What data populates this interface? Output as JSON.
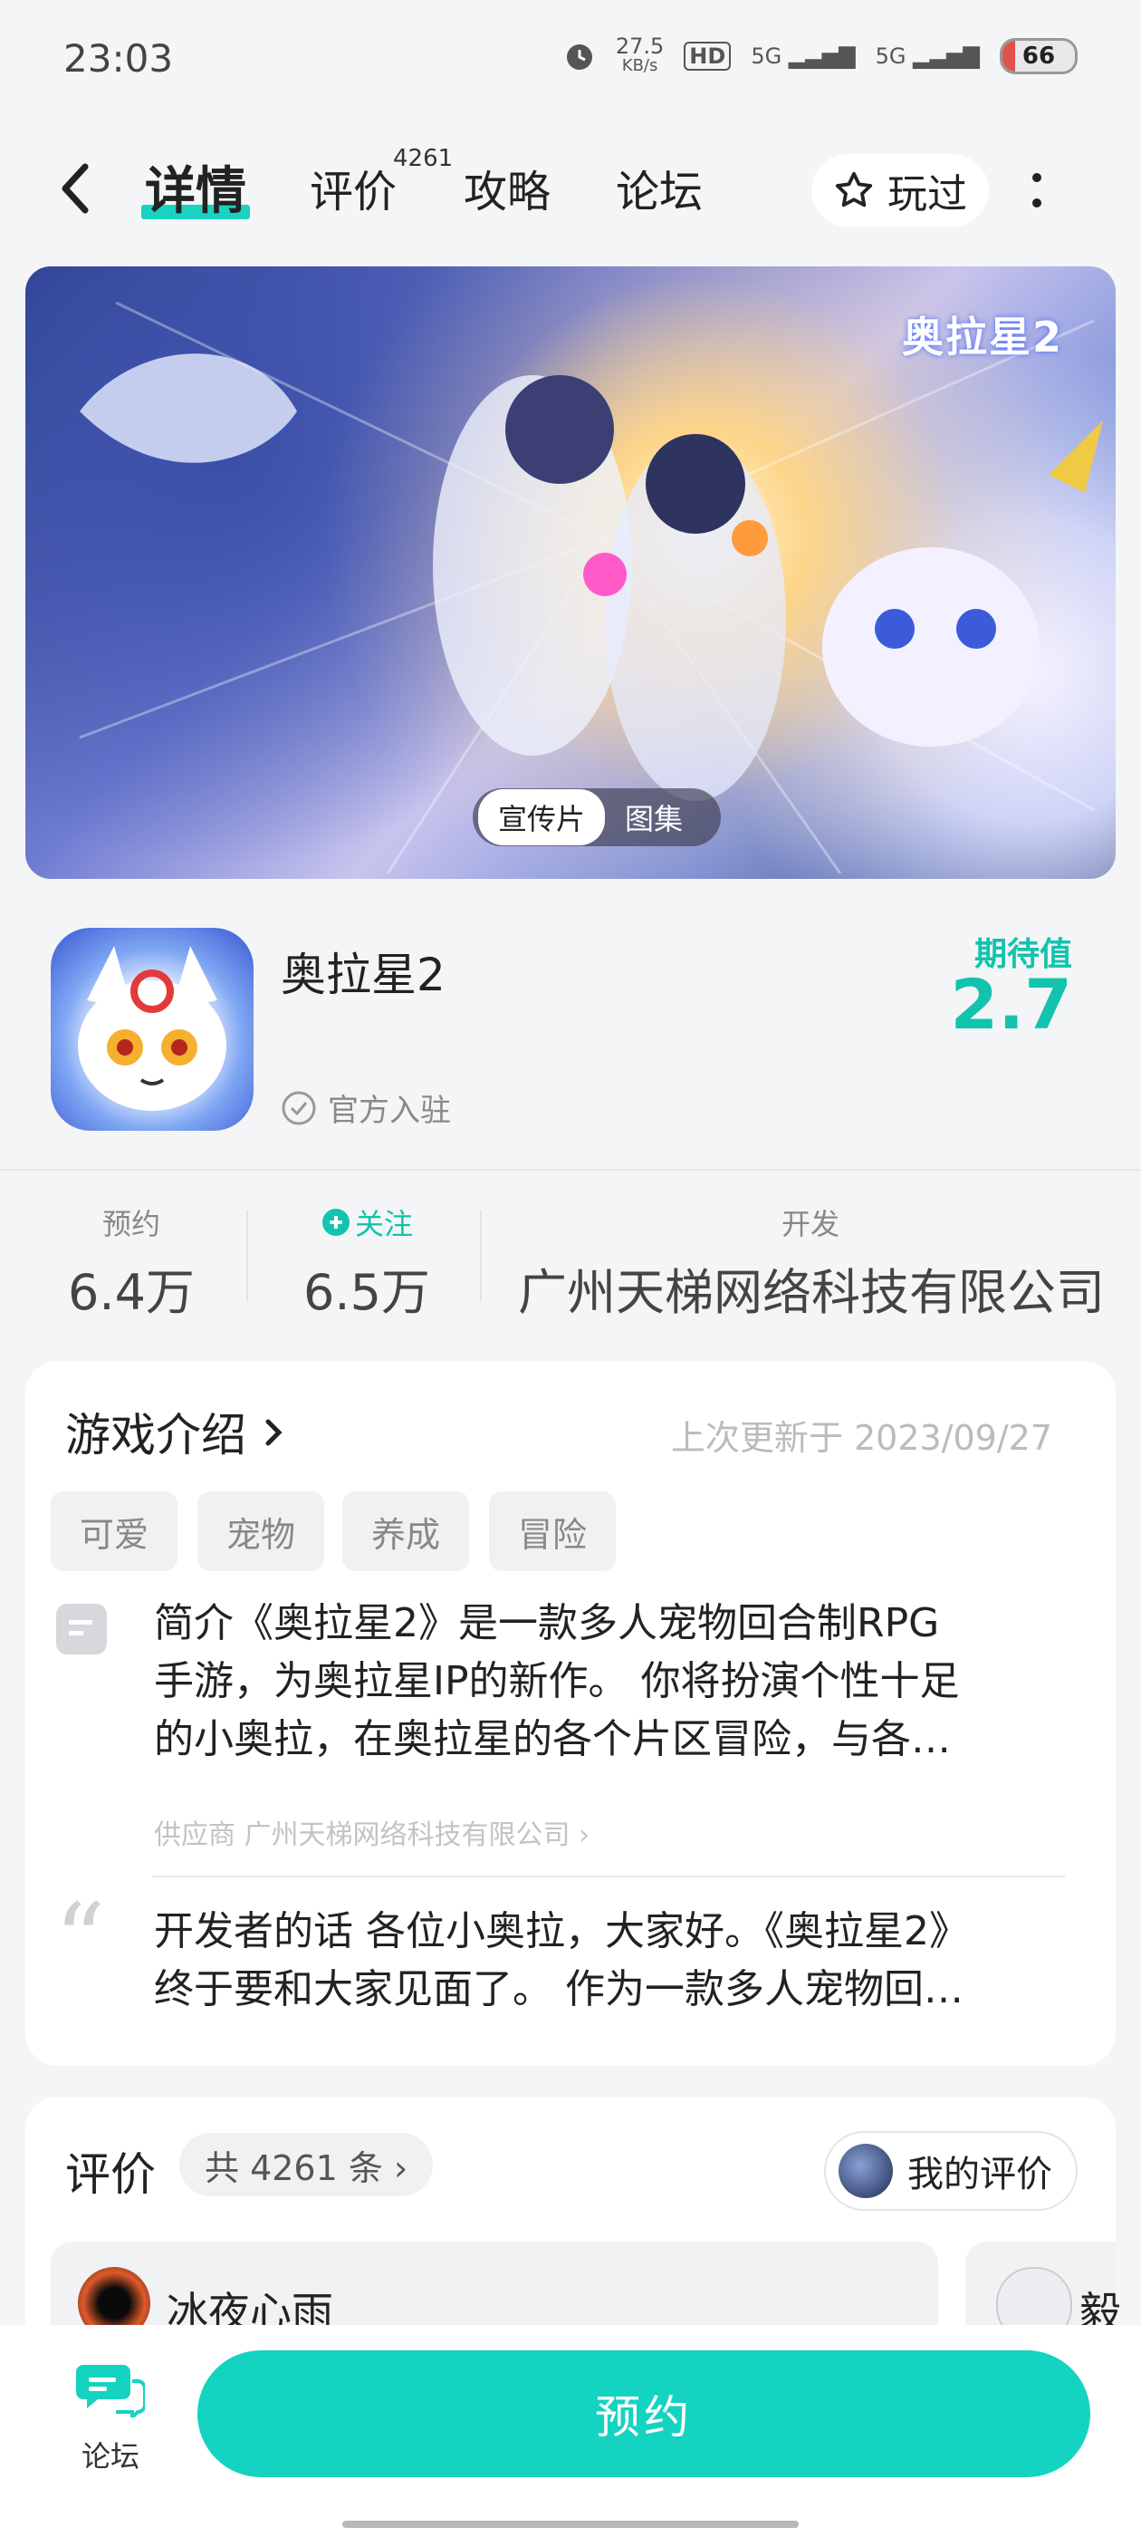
{
  "status_bar": {
    "time": "23:03",
    "net_speed": "27.5",
    "net_unit": "KB/s",
    "hd": "HD",
    "sig1": "5G",
    "sig2": "5G",
    "battery": "66"
  },
  "header": {
    "tabs": [
      {
        "label": "详情",
        "active": true
      },
      {
        "label": "评价",
        "badge": "4261"
      },
      {
        "label": "攻略"
      },
      {
        "label": "论坛"
      }
    ],
    "played_label": "玩过"
  },
  "banner": {
    "logo_text": "奥拉星2",
    "tabs": [
      "宣传片",
      "图集"
    ],
    "active_tab": "宣传片"
  },
  "app": {
    "name": "奥拉星2",
    "official_label": "官方入驻",
    "expect_label": "期待值",
    "expect_value": "2.7"
  },
  "stats": {
    "reserve_label": "预约",
    "reserve_value": "6.4万",
    "follow_label": "关注",
    "follow_value": "6.5万",
    "dev_label": "开发",
    "dev_value": "广州天梯网络科技有限公司"
  },
  "intro": {
    "title": "游戏介绍",
    "updated": "上次更新于 2023/09/27",
    "tags": [
      "可爱",
      "宠物",
      "养成",
      "冒险"
    ],
    "summary_label": "简介",
    "summary_line1": "简介《奥拉星2》是一款多人宠物回合制RPG",
    "summary_line2": "手游，为奥拉星IP的新作。 你将扮演个性十足",
    "summary_line3": "的小奥拉，在奥拉星的各个片区冒险，与各…",
    "supplier": "供应商 广州天梯网络科技有限公司 ›",
    "dev_line1": "开发者的话 各位小奥拉，大家好。《奥拉星2》",
    "dev_line2": "终于要和大家见面了。 作为一款多人宠物回…"
  },
  "reviews": {
    "title": "评价",
    "count": "共 4261 条 ›",
    "my_review": "我的评价",
    "items": [
      {
        "name": "冰夜心雨"
      },
      {
        "name": "毅"
      }
    ]
  },
  "bottom": {
    "forum_label": "论坛",
    "reserve_button": "预约"
  },
  "colors": {
    "accent": "#15d3c1",
    "accent_text": "#12c3ad",
    "background": "#f4f5f7"
  }
}
